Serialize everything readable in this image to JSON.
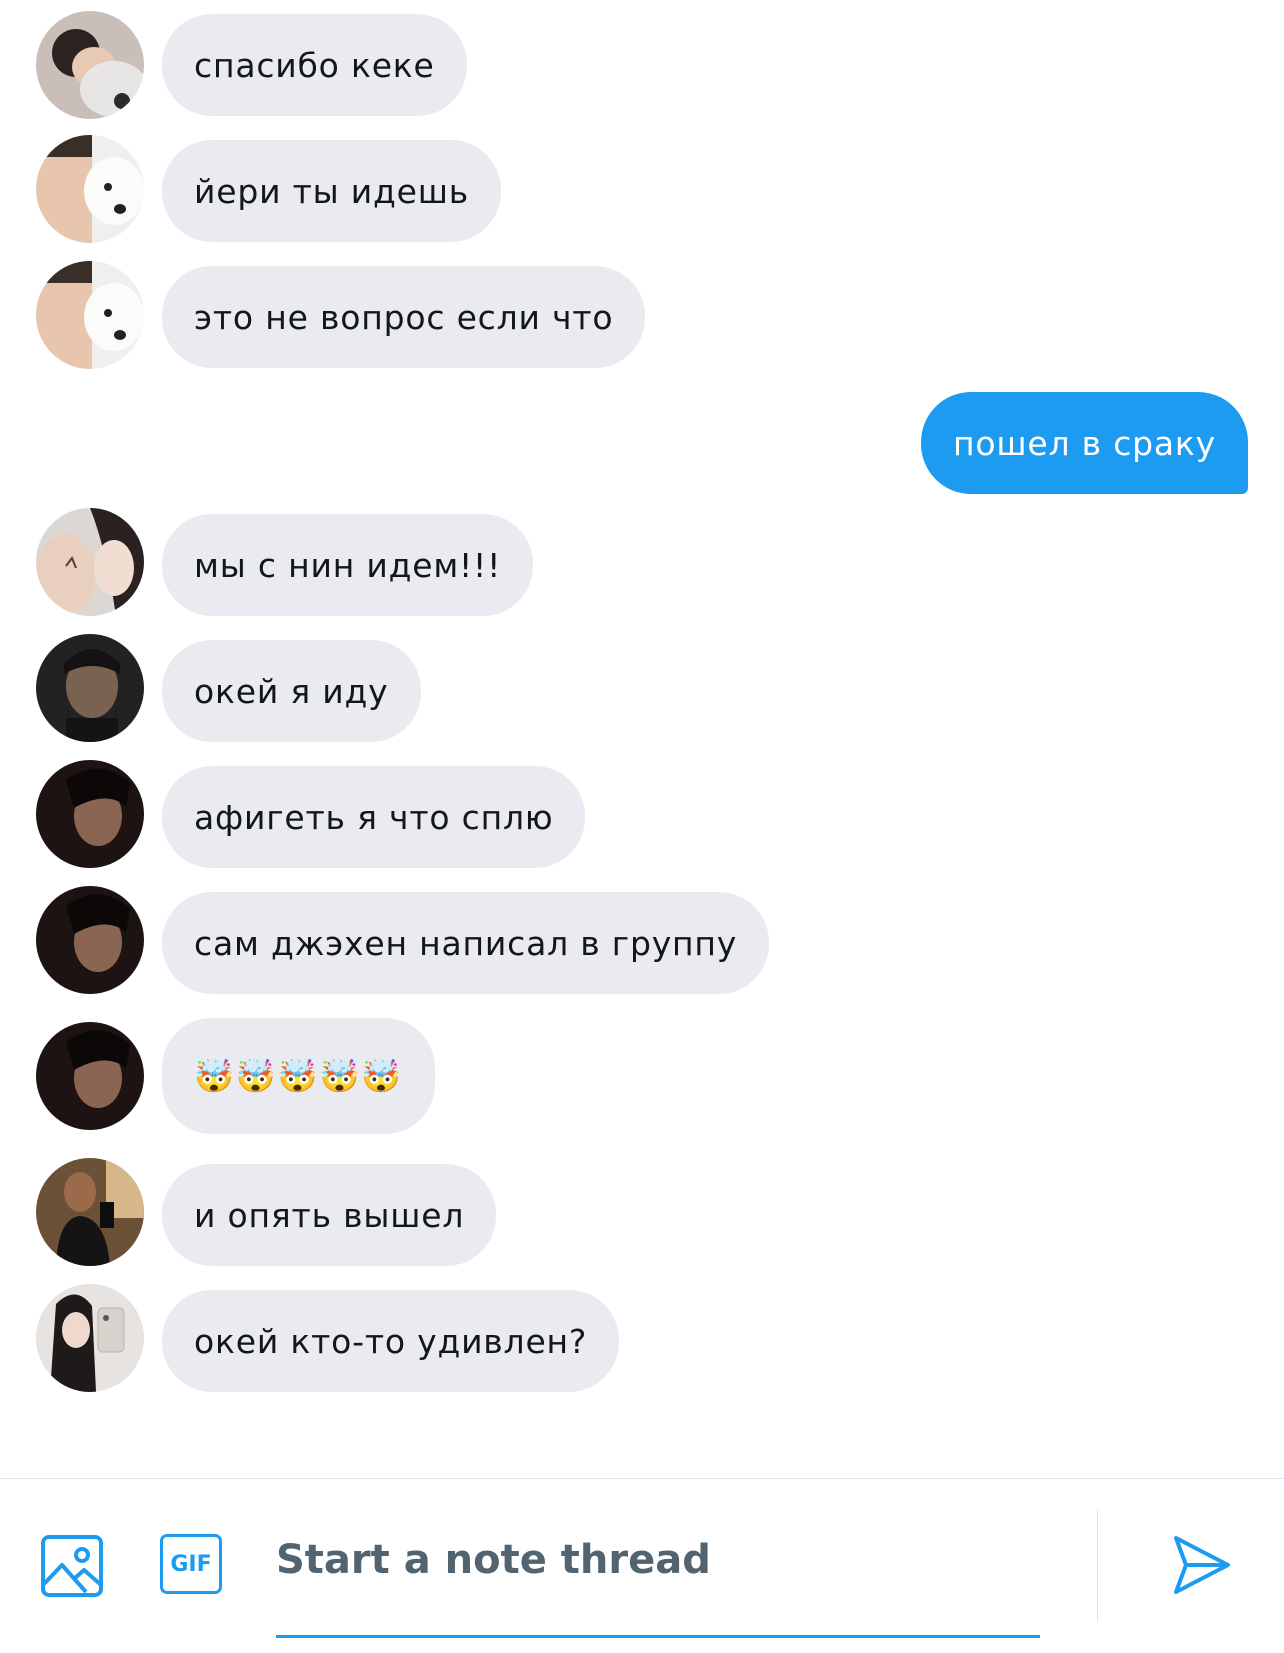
{
  "colors": {
    "accent": "#1d9bf0",
    "incoming_bubble": "#e9ebf0",
    "incoming_text": "#14171a",
    "outgoing_text": "#ffffff",
    "placeholder": "#536471"
  },
  "messages": [
    {
      "direction": "incoming",
      "text": "спасибо кеке",
      "avatar": "user-photo-1"
    },
    {
      "direction": "incoming",
      "text": "йери ты идешь",
      "avatar": "user-photo-2"
    },
    {
      "direction": "incoming",
      "text": "это не вопрос если что",
      "avatar": "user-photo-2"
    },
    {
      "direction": "outgoing",
      "text": "пошел в сраку"
    },
    {
      "direction": "incoming",
      "text": "мы с нин идем!!!",
      "avatar": "user-photo-3"
    },
    {
      "direction": "incoming",
      "text": "окей я иду",
      "avatar": "user-photo-4"
    },
    {
      "direction": "incoming",
      "text": "афигеть я что сплю",
      "avatar": "user-photo-5"
    },
    {
      "direction": "incoming",
      "text": "сам джэхен написал в группу",
      "avatar": "user-photo-5"
    },
    {
      "direction": "incoming",
      "text": "🤯🤯🤯🤯🤯",
      "avatar": "user-photo-5"
    },
    {
      "direction": "incoming",
      "text": "и опять вышел",
      "avatar": "user-photo-6"
    },
    {
      "direction": "incoming",
      "text": "окей кто-то удивлен?",
      "avatar": "user-photo-7"
    }
  ],
  "composer": {
    "image_icon": "image-icon",
    "gif_label": "GIF",
    "placeholder": "Start a note thread",
    "value": "",
    "send_icon": "send-icon"
  }
}
